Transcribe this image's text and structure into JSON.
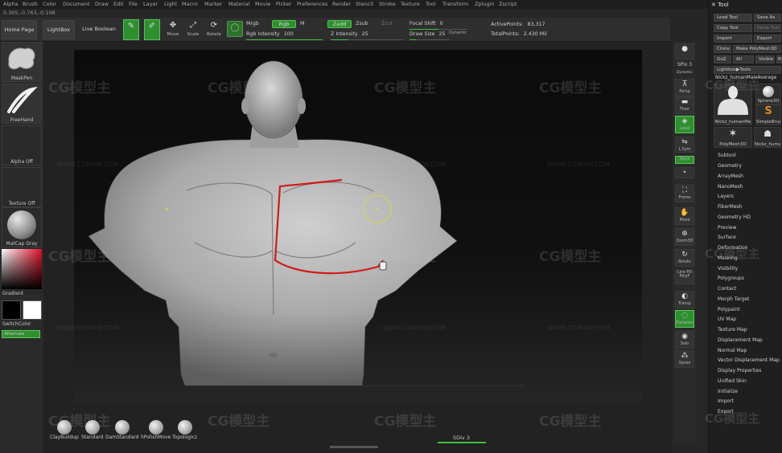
{
  "menu": {
    "items": [
      "Alpha",
      "Brush",
      "Color",
      "Document",
      "Draw",
      "Edit",
      "File",
      "Layer",
      "Light",
      "Macro",
      "Marker",
      "Material",
      "Movie",
      "Picker",
      "Preferences",
      "Render",
      "Stencil",
      "Stroke",
      "Texture",
      "Tool",
      "Transform",
      "Zplugin",
      "Zscript"
    ]
  },
  "coords": "0.305,-0.763,-0.108",
  "topbar": {
    "home_page": "Home Page",
    "lightbox": "LightBox",
    "live_boolean": "Live Boolean",
    "edit_label": "Edit",
    "draw_label": "Draw",
    "move_label": "Move",
    "scale_label": "Scale",
    "rotate_label": "Rotate",
    "mrgb": "Mrgb",
    "rgb": "Rgb",
    "m": "M",
    "zadd": "Zadd",
    "zsub": "Zsub",
    "zcut": "Zcut",
    "rgb_intensity_label": "Rgb Intensity",
    "rgb_intensity_value": "100",
    "z_intensity_label": "Z Intensity",
    "z_intensity_value": "25",
    "focal_shift_label": "Focal Shift",
    "focal_shift_value": "0",
    "draw_size_label": "Draw Size",
    "draw_size_value": "25",
    "dynamic": "Dynamic",
    "active_points_label": "ActivePoints:",
    "active_points_value": "83,317",
    "total_points_label": "TotalPoints:",
    "total_points_value": "2.430 Mil"
  },
  "left_shelf": {
    "maskpen": "MaskPen",
    "freehand": "FreeHand",
    "alpha_off": "Alpha Off",
    "texture_off": "Texture Off",
    "matcap_gray": "MatCap Gray",
    "gradient": "Gradient",
    "switchcolor": "SwitchColor",
    "alternate": "Alternate"
  },
  "right_shelf": {
    "spix": "SPix 3",
    "dynamic": "Dynamic",
    "persp": "Persp",
    "floor": "Floor",
    "local": "Local",
    "lsym": "L.Sym",
    "xyz": "Qxyz",
    "frame": "Frame",
    "move": "Move",
    "zoom3d": "Zoom3D",
    "rotate": "Rotate",
    "line_fill": "Line Fill",
    "polyf": "PolyF",
    "transp": "Transp",
    "dynamic2": "Dynamic",
    "solo": "Solo",
    "xpose": "Xpose"
  },
  "tool_panel": {
    "title": "Tool",
    "load_tool": "Load Tool",
    "save_as": "Save As",
    "copy_tool": "Copy Tool",
    "paste_tool": "Paste Tool",
    "import": "Import",
    "export": "Export",
    "clone": "Clone",
    "make_polymesh": "Make PolyMesh3D",
    "goz": "GoZ",
    "all": "All",
    "visible": "Visible",
    "r": "R",
    "lightbox_tools": "Lightbox▶Tools",
    "current_tool": "Nickz_humanMaleAverage",
    "thumbs": [
      "Nickz_humanMa",
      "Sphere3D",
      "SimpleBrush",
      "PolyMesh3D",
      "Nickz_huma"
    ],
    "subpalettes": [
      "Subtool",
      "Geometry",
      "ArrayMesh",
      "NanoMesh",
      "Layers",
      "FiberMesh",
      "Geometry HD",
      "Preview",
      "Surface",
      "Deformation",
      "Masking",
      "Visibility",
      "Polygroups",
      "Contact",
      "Morph Target",
      "Polypaint",
      "UV Map",
      "Texture Map",
      "Displacement Map",
      "Normal Map",
      "Vector Displacement Map",
      "Display Properties",
      "Unified Skin",
      "Initialize",
      "Import",
      "Export"
    ]
  },
  "brushes": [
    "ClayBuildup",
    "Standard",
    "DamStandard",
    "hPolishMove",
    "Topologicz"
  ],
  "sdiv": "SDiv 3",
  "watermark": {
    "logo": "CG模型主",
    "url": "WWW.CGMXW.COM"
  },
  "colors": {
    "accent_green": "#3fbf3f",
    "mask_stroke": "#d11a1a",
    "cursor_ring": "#d8d84a"
  }
}
